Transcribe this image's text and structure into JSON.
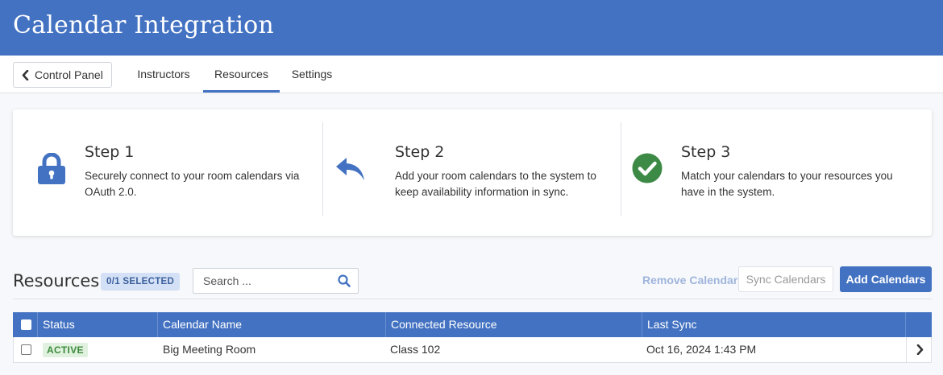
{
  "header": {
    "title": "Calendar Integration"
  },
  "nav": {
    "back_label": "Control Panel",
    "tabs": [
      {
        "label": "Instructors"
      },
      {
        "label": "Resources"
      },
      {
        "label": "Settings"
      }
    ],
    "active_tab": "Resources"
  },
  "steps": [
    {
      "title": "Step 1",
      "description": "Securely connect to your room calendars via OAuth 2.0.",
      "icon": "lock-icon"
    },
    {
      "title": "Step 2",
      "description": "Add your room calendars to the system to keep availability information in sync.",
      "icon": "reply-arrow-icon"
    },
    {
      "title": "Step 3",
      "description": "Match your calendars to your resources you have in the system.",
      "icon": "check-circle-icon"
    }
  ],
  "resources": {
    "title": "Resources",
    "selected_badge": "0/1 SELECTED",
    "search_placeholder": "Search ...",
    "remove_label": "Remove Calendar",
    "sync_label": "Sync Calendars",
    "add_label": "Add Calendars"
  },
  "table": {
    "columns": [
      "Status",
      "Calendar Name",
      "Connected Resource",
      "Last Sync"
    ],
    "rows": [
      {
        "status": "ACTIVE",
        "calendar_name": "Big Meeting Room",
        "connected_resource": "Class 102",
        "last_sync": "Oct 16, 2024 1:43 PM"
      }
    ]
  },
  "colors": {
    "brand": "#4372c2",
    "step_icon": "#4372c2",
    "success": "#3d8a46",
    "active_badge_bg": "#e0f2df",
    "selected_badge_bg": "#d3e0f5"
  }
}
